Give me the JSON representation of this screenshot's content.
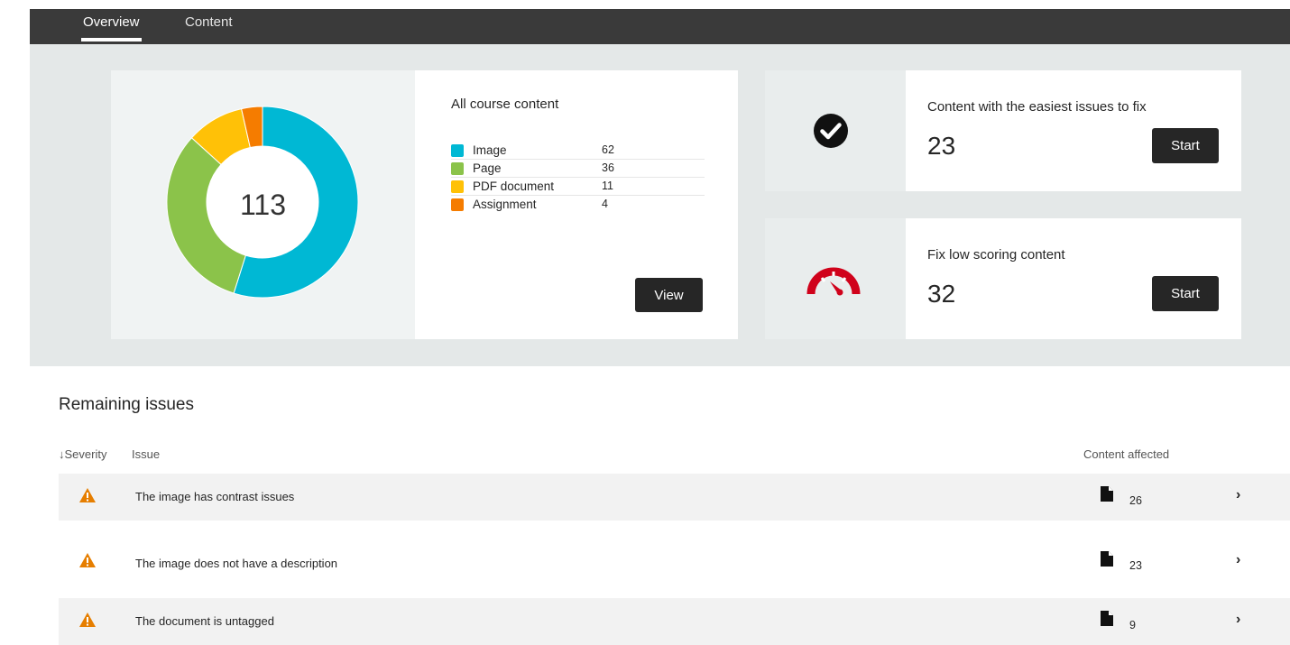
{
  "tabs": [
    {
      "label": "Overview"
    },
    {
      "label": "Content"
    }
  ],
  "overview": {
    "total": "113",
    "breakdown_title": "All course content",
    "items": [
      {
        "label": "Image",
        "count": "62",
        "color": "#00b8d4"
      },
      {
        "label": "Page",
        "count": "36",
        "color": "#8bc34a"
      },
      {
        "label": "PDF document",
        "count": "11",
        "color": "#ffc107"
      },
      {
        "label": "Assignment",
        "count": "4",
        "color": "#f57c00"
      }
    ],
    "view_label": "View"
  },
  "easiest": {
    "title": "Content with the easiest issues to fix",
    "count": "23",
    "start_label": "Start",
    "icon": "check-circle-icon"
  },
  "low_scoring": {
    "title": "Fix low scoring content",
    "count": "32",
    "start_label": "Start",
    "icon": "speedometer-icon",
    "icon_color": "#d0021b"
  },
  "issues": {
    "title": "Remaining issues",
    "columns": {
      "severity": "↓Severity",
      "issue": "Issue",
      "affected": "Content affected"
    },
    "rows": [
      {
        "text": "The image has contrast issues",
        "count": "26"
      },
      {
        "text": "The image does not have a description",
        "count": "23"
      },
      {
        "text": "The document is untagged",
        "count": "9"
      }
    ],
    "warning_color": "#e67e00"
  }
}
